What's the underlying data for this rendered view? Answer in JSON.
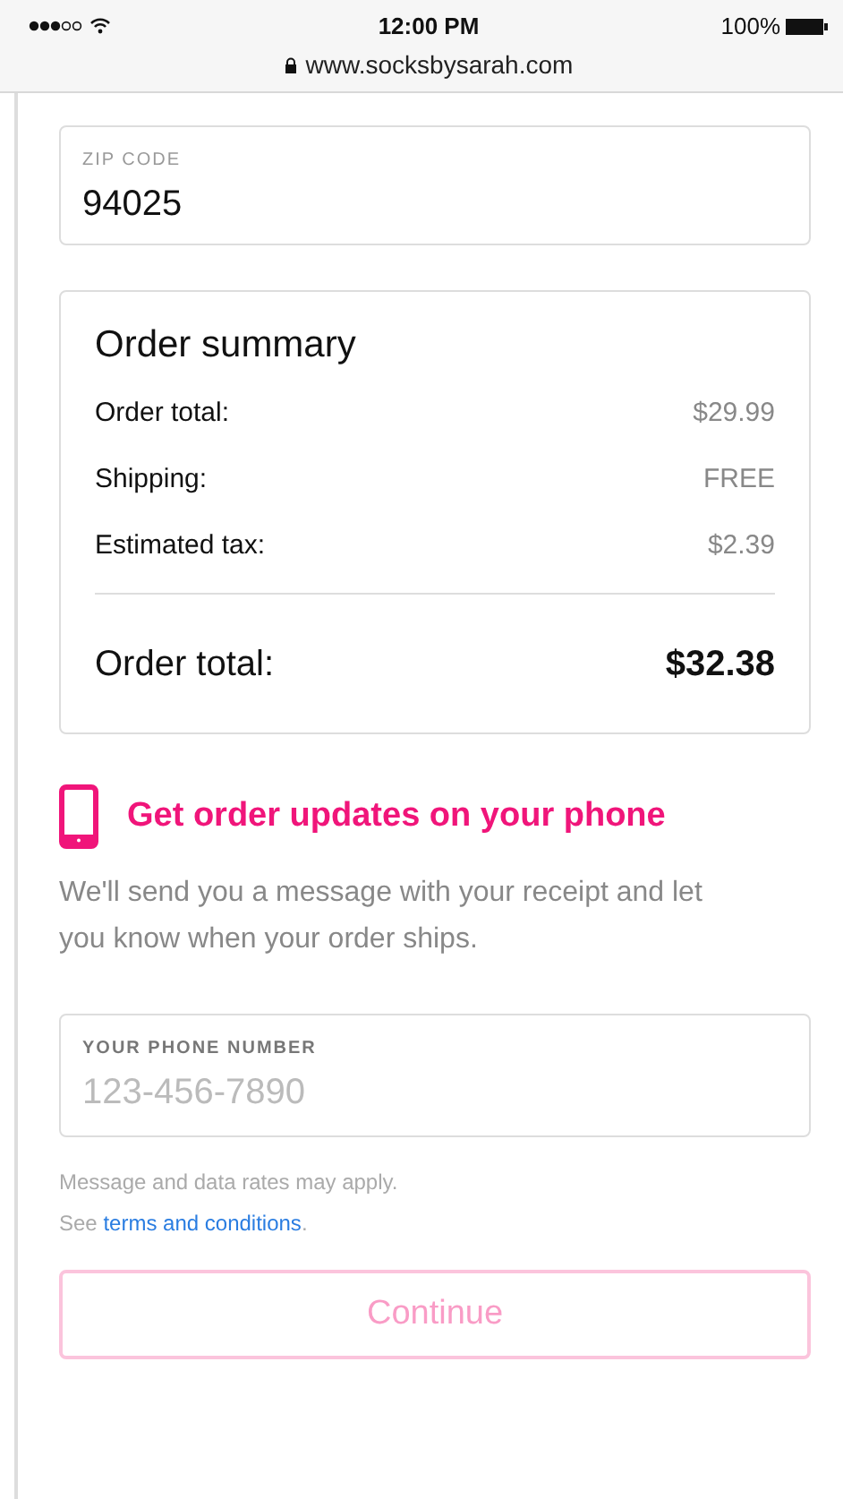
{
  "status_bar": {
    "time": "12:00 PM",
    "battery": "100%",
    "url": "www.socksbysarah.com"
  },
  "zip": {
    "label": "ZIP CODE",
    "value": "94025"
  },
  "summary": {
    "title": "Order summary",
    "rows": [
      {
        "label": "Order total:",
        "value": "$29.99"
      },
      {
        "label": "Shipping:",
        "value": "FREE"
      },
      {
        "label": "Estimated tax:",
        "value": "$2.39"
      }
    ],
    "total": {
      "label": "Order total:",
      "value": "$32.38"
    }
  },
  "updates": {
    "title": "Get order updates on your phone",
    "text": "We'll send you a message with your receipt and let you know when your order ships."
  },
  "phone": {
    "label": "YOUR PHONE NUMBER",
    "placeholder": "123-456-7890"
  },
  "disclaimer": {
    "line1": "Message and data rates may apply.",
    "see": "See",
    "link": "terms and conditions",
    "end": "."
  },
  "continue": {
    "label": "Continue",
    "disabled": true
  }
}
